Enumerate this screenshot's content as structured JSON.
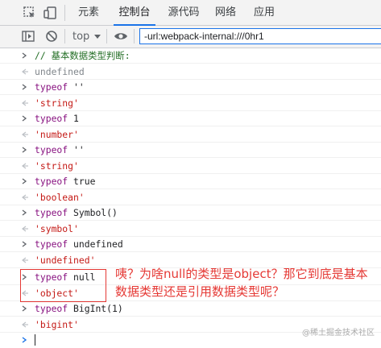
{
  "tabs": [
    {
      "label": "元素",
      "active": false
    },
    {
      "label": "控制台",
      "active": true
    },
    {
      "label": "源代码",
      "active": false
    },
    {
      "label": "网络",
      "active": false
    },
    {
      "label": "应用",
      "active": false
    }
  ],
  "toolbar": {
    "context": "top",
    "filter_value": "-url:webpack-internal:///0hr1"
  },
  "console": [
    {
      "kind": "input",
      "keyword": "",
      "text": "",
      "comment": "// 基本数据类型判断:"
    },
    {
      "kind": "output",
      "value": "undefined"
    },
    {
      "kind": "input",
      "keyword": "typeof",
      "text": " ''"
    },
    {
      "kind": "output",
      "value": "'string'"
    },
    {
      "kind": "input",
      "keyword": "typeof",
      "text": " 1"
    },
    {
      "kind": "output",
      "value": "'number'"
    },
    {
      "kind": "input",
      "keyword": "typeof",
      "text": " ''"
    },
    {
      "kind": "output",
      "value": "'string'"
    },
    {
      "kind": "input",
      "keyword": "typeof",
      "text": " true"
    },
    {
      "kind": "output",
      "value": "'boolean'"
    },
    {
      "kind": "input",
      "keyword": "typeof",
      "text": " Symbol()"
    },
    {
      "kind": "output",
      "value": "'symbol'"
    },
    {
      "kind": "input",
      "keyword": "typeof",
      "text": " undefined"
    },
    {
      "kind": "output",
      "value": "'undefined'"
    },
    {
      "kind": "input",
      "keyword": "typeof",
      "text": " null"
    },
    {
      "kind": "output",
      "value": "'object'"
    },
    {
      "kind": "input",
      "keyword": "typeof",
      "text": " BigInt(1)"
    },
    {
      "kind": "output",
      "value": "'bigint'"
    }
  ],
  "annotation": "咦？为啥null的类型是object？那它到底是基本数据类型还是引用数据类型呢？",
  "watermark": "@稀土掘金技术社区",
  "colors": {
    "accent": "#1a73e8",
    "annotation": "#e53935",
    "string": "#c41a16",
    "keyword": "#881280",
    "comment": "#236e25"
  }
}
